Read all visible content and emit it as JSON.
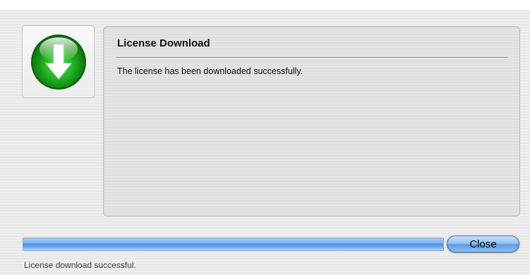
{
  "dialog": {
    "icon": "download-arrow-icon",
    "title": "License Download",
    "message": "The license has been downloaded successfully."
  },
  "progress": {
    "value_percent": 100,
    "color": "#4f93e6"
  },
  "actions": {
    "close_label": "Close"
  },
  "status": {
    "text": "License download successful."
  }
}
